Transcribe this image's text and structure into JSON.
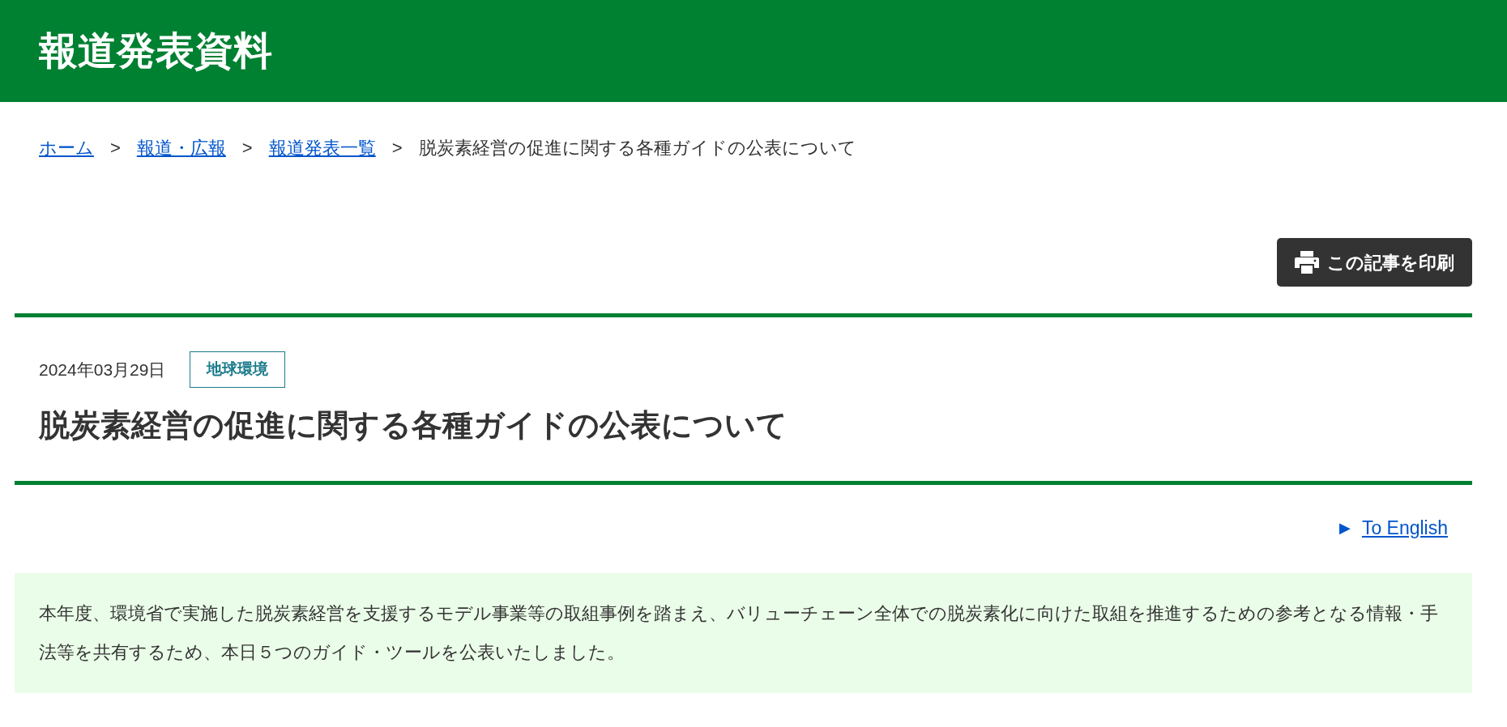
{
  "header": {
    "title": "報道発表資料"
  },
  "breadcrumb": [
    {
      "label": "ホーム",
      "link": true
    },
    {
      "label": "報道・広報",
      "link": true
    },
    {
      "label": "報道発表一覧",
      "link": true
    },
    {
      "label": "脱炭素経営の促進に関する各種ガイドの公表について",
      "link": false
    }
  ],
  "breadcrumb_separator": ">",
  "print_button": {
    "label": "この記事を印刷"
  },
  "article": {
    "date": "2024年03月29日",
    "tag": "地球環境",
    "title": "脱炭素経営の促進に関する各種ガイドの公表について"
  },
  "english_link": {
    "marker": "▶",
    "label": "To English"
  },
  "summary": "本年度、環境省で実施した脱炭素経営を支援するモデル事業等の取組事例を踏まえ、バリューチェーン全体での脱炭素化に向けた取組を推進するための参考となる情報・手法等を共有するため、本日５つのガイド・ツールを公表いたしました。"
}
